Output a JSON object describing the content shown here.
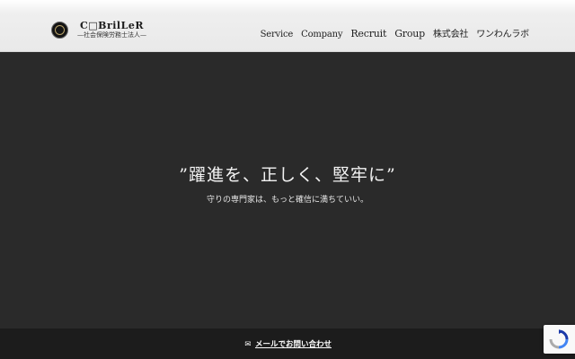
{
  "header": {
    "logo_name": "C□BrilLeR",
    "logo_sub": "—社会保険労務士法人—",
    "logo_icon": "emblem-icon",
    "nav": [
      {
        "label": "Service"
      },
      {
        "label": "Company"
      },
      {
        "label": "Recruit"
      },
      {
        "label": "Group"
      },
      {
        "label": "株式会社"
      },
      {
        "label": "ワンわんラボ"
      }
    ]
  },
  "hero": {
    "title": "”躍進を、正しく、堅牢に”",
    "subtitle": "守りの専門家は、もっと確信に満ちていい。"
  },
  "footer": {
    "contact_icon": "✉",
    "contact_label": "メールでお問い合わせ"
  },
  "colors": {
    "hero_bg": "#2a2a2a",
    "footer_bg": "#1c1c1c",
    "header_bg": "#ececec"
  }
}
